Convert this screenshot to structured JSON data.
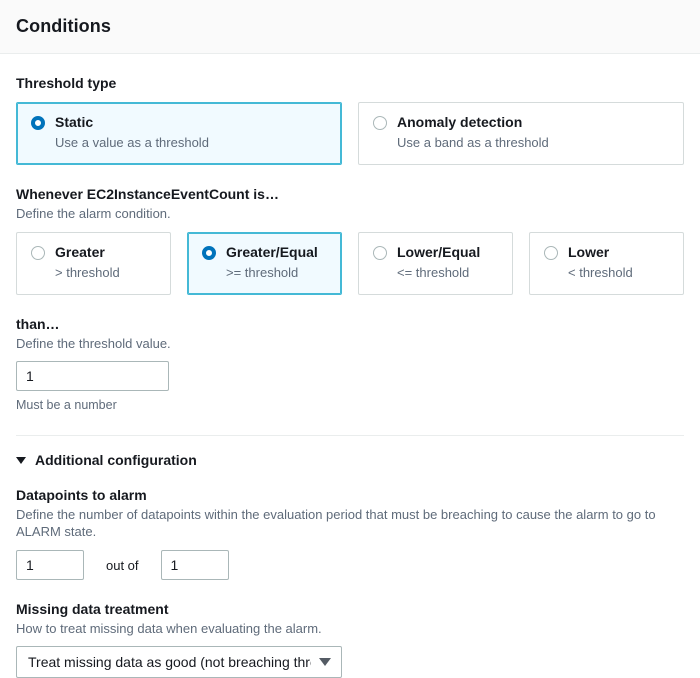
{
  "header": {
    "title": "Conditions"
  },
  "threshold_type": {
    "label": "Threshold type",
    "options": [
      {
        "title": "Static",
        "subtitle": "Use a value as a threshold",
        "selected": true
      },
      {
        "title": "Anomaly detection",
        "subtitle": "Use a band as a threshold",
        "selected": false
      }
    ]
  },
  "condition": {
    "label": "Whenever EC2InstanceEventCount is…",
    "description": "Define the alarm condition.",
    "metric_name": "EC2InstanceEventCount",
    "options": [
      {
        "title": "Greater",
        "subtitle": "> threshold",
        "selected": false
      },
      {
        "title": "Greater/Equal",
        "subtitle": ">= threshold",
        "selected": true
      },
      {
        "title": "Lower/Equal",
        "subtitle": "<= threshold",
        "selected": false
      },
      {
        "title": "Lower",
        "subtitle": "< threshold",
        "selected": false
      }
    ]
  },
  "threshold_value": {
    "label": "than…",
    "description": "Define the threshold value.",
    "value": "1",
    "placeholder": "",
    "hint": "Must be a number"
  },
  "additional_configuration": {
    "label": "Additional configuration",
    "expanded": true,
    "datapoints": {
      "label": "Datapoints to alarm",
      "description": "Define the number of datapoints within the evaluation period that must be breaching to cause the alarm to go to ALARM state.",
      "breaching_value": "1",
      "between_label": "out of",
      "evaluation_value": "1"
    },
    "missing_data": {
      "label": "Missing data treatment",
      "description": "How to treat missing data when evaluating the alarm.",
      "selected": "Treat missing data as good (not breaching thre…"
    }
  },
  "colors": {
    "accent": "#0073bb",
    "selected_border": "#44b9d6",
    "selected_background": "#f1faff",
    "border": "#aab7b8",
    "muted_text": "#5f6b7a"
  }
}
